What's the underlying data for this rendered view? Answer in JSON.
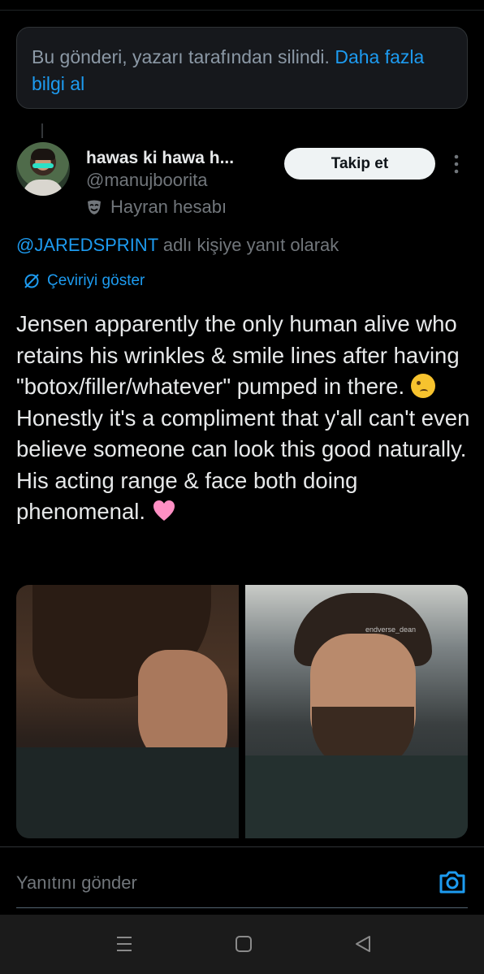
{
  "deleted_notice": {
    "text": "Bu gönderi, yazarı tarafından silindi.",
    "link": "Daha fazla bilgi al"
  },
  "author": {
    "name": "hawas ki hawa h...",
    "handle": "@manujboorita",
    "label": "Hayran hesabı"
  },
  "follow_button": "Takip et",
  "reply_to": {
    "mention": "@JAREDSPRINT",
    "suffix": "adlı kişiye yanıt olarak"
  },
  "translate_label": "Çeviriyi göster",
  "tweet": {
    "text_part1": "Jensen apparently the only human alive who retains his wrinkles & smile lines after having \"botox/filler/whatever\" pumped in there.",
    "emoji1": "woozy-face",
    "text_part2": "Honestly it's a compliment that y'all can't even believe someone can look this good naturally. His acting range & face both doing phenomenal.",
    "emoji2": "pink-heart"
  },
  "media": {
    "watermark": "endverse_dean"
  },
  "reply_composer": {
    "placeholder": "Yanıtını gönder"
  },
  "colors": {
    "background": "#000000",
    "accent": "#1d9bf0",
    "secondary_text": "#71767b",
    "heart": "#ff8fc4"
  }
}
